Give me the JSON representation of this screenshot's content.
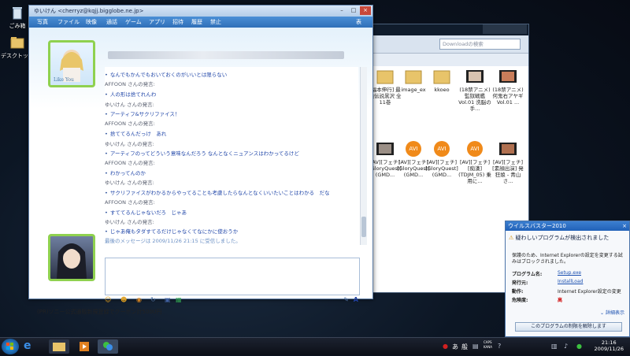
{
  "desktop": {
    "icons": [
      {
        "label": "ごみ箱",
        "icon": "recycle-bin-icon"
      },
      {
        "label": "デスクトップ",
        "icon": "folder-icon"
      }
    ]
  },
  "explorer": {
    "search_placeholder": "Downloadの検索",
    "files": [
      {
        "name": "[福本伸行] 最強伝説黒沢 全11巻",
        "icon": "folder-icon"
      },
      {
        "name": "image_ex",
        "icon": "folder-icon"
      },
      {
        "name": "kkoeo",
        "icon": "folder-icon"
      },
      {
        "name": "(18禁アニメ) 監獄戦艦 Vol.01 洗脳の手...",
        "icon": "video-icon"
      },
      {
        "name": "(18禁アニメ) 何鬼右アヤギ Vol.01 ...",
        "icon": "video-icon"
      },
      {
        "name": "[AV][フェチ][GloryQuest](GMD...",
        "icon": "video-icon"
      },
      {
        "name": "[AV][フェチ][GloryQuest](GMD...",
        "icon": "avi-icon"
      },
      {
        "name": "[AV][フェチ][GloryQuest](GMD...",
        "icon": "avi-icon"
      },
      {
        "name": "[AV][フェチ][痴漢](TDJM_05) 乗用に...",
        "icon": "avi-icon"
      },
      {
        "name": "[AV][フェチ][素顔出演] 発狂娘 - 青山さ...",
        "icon": "video-icon"
      }
    ]
  },
  "messenger": {
    "title": "ゆいけん <cherryz@kqjj.bigglobe.ne.jp>",
    "menu": [
      "写真",
      "ファイル",
      "映像",
      "通話",
      "ゲーム",
      "アプリ",
      "招待",
      "履歴",
      "禁止"
    ],
    "menu_right": "表",
    "avatar_caption": "Like You",
    "conversation": [
      {
        "type": "message",
        "text": "なんでもかんでもおいておくのがいいとは限らない"
      },
      {
        "type": "speaker",
        "text": "AFFOON さんの発言:"
      },
      {
        "type": "message",
        "text": "人の形は捨てれんわ"
      },
      {
        "type": "speaker",
        "text": "ゆいけん さんの発言:"
      },
      {
        "type": "message",
        "text": "アーティフ&サクリファイス！"
      },
      {
        "type": "speaker",
        "text": "AFFOON さんの発言:"
      },
      {
        "type": "message",
        "text": "捨ててるんだっけ　あれ"
      },
      {
        "type": "speaker",
        "text": "ゆいけん さんの発言:"
      },
      {
        "type": "message",
        "text": "アーティフのってどういう意味なんだろう なんとなくニュアンスはわかってるけど"
      },
      {
        "type": "speaker",
        "text": "AFFOON さんの発言:"
      },
      {
        "type": "message",
        "text": "わかってんのか"
      },
      {
        "type": "speaker",
        "text": "ゆいけん さんの発言:"
      },
      {
        "type": "message",
        "text": "サクリファイスがわかるからやってることも考慮したらなんとなくいいたいことはわかる　だな"
      },
      {
        "type": "speaker",
        "text": "AFFOON さんの発言:"
      },
      {
        "type": "message",
        "text": "すててるんじゃないだろ　じゃあ"
      },
      {
        "type": "speaker",
        "text": "ゆいけん さんの発言:"
      },
      {
        "type": "message",
        "text": "じゃあ俺もタダすてるだけじゃなくてなにかに使おうか"
      },
      {
        "type": "info",
        "text": "最後のメッセージは 2009/11/26 21:15 に受信しました。"
      }
    ],
    "ad_text": "(PR)ソニー公式通販新規登録でクーポン計5000円"
  },
  "alert": {
    "title": "ウイルスバスター2010",
    "heading": "疑わしいプログラムが検出されました",
    "description": "保護のため、Internet Explorerの設定を変更する試みはブロックされました。",
    "rows": [
      {
        "key": "プログラム名:",
        "value": "Setup.exe",
        "link": true
      },
      {
        "key": "発行元:",
        "value": "InstallLoad",
        "link": true
      },
      {
        "key": "動作:",
        "value": "Internet Explorer設定の変更",
        "link": false
      },
      {
        "key": "危険度:",
        "value": "高",
        "link": false
      }
    ],
    "details_link": "詳細表示",
    "button_label": "このプログラムの制限を解除します"
  },
  "taskbar": {
    "tray": [
      "あ",
      "般",
      "CAPS",
      "KANA"
    ],
    "time": "21:16",
    "date": "2009/11/26"
  }
}
